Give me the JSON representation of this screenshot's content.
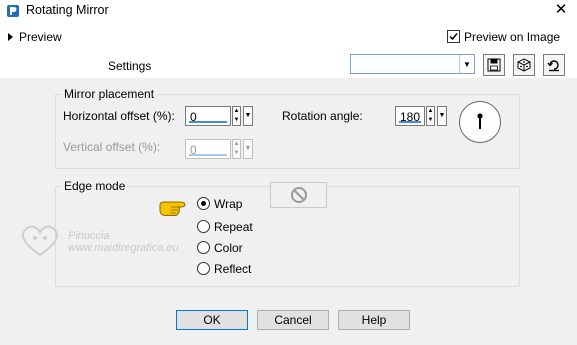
{
  "window": {
    "title": "Rotating Mirror",
    "close_glyph": "✕",
    "icon": "app-logo-icon"
  },
  "preview": {
    "label": "Preview",
    "preview_on_image_label": "Preview on Image",
    "preview_on_image_checked": true
  },
  "settings": {
    "label": "Settings",
    "value": "",
    "buttons": [
      "save-preset-icon",
      "randomize-dice-icon",
      "reset-icon"
    ]
  },
  "mirror_placement": {
    "title": "Mirror placement",
    "horizontal_offset": {
      "label": "Horizontal offset (%):",
      "value": "0"
    },
    "vertical_offset": {
      "label": "Vertical offset (%):",
      "value": "0",
      "disabled": true
    },
    "rotation_angle": {
      "label": "Rotation angle:",
      "value": "180"
    }
  },
  "edge_mode": {
    "title": "Edge mode",
    "options": [
      {
        "label": "Wrap",
        "selected": true
      },
      {
        "label": "Repeat",
        "selected": false
      },
      {
        "label": "Color",
        "selected": false
      },
      {
        "label": "Reflect",
        "selected": false
      }
    ]
  },
  "buttons": {
    "ok": "OK",
    "cancel": "Cancel",
    "help": "Help"
  },
  "watermark": {
    "line1": "Pinuccia",
    "line2": "www.maidiregrafica.eu"
  },
  "colors": {
    "accent": "#0078d7",
    "spin_underline": "#3c8ee0",
    "pointer_hand": "#f5c400"
  }
}
